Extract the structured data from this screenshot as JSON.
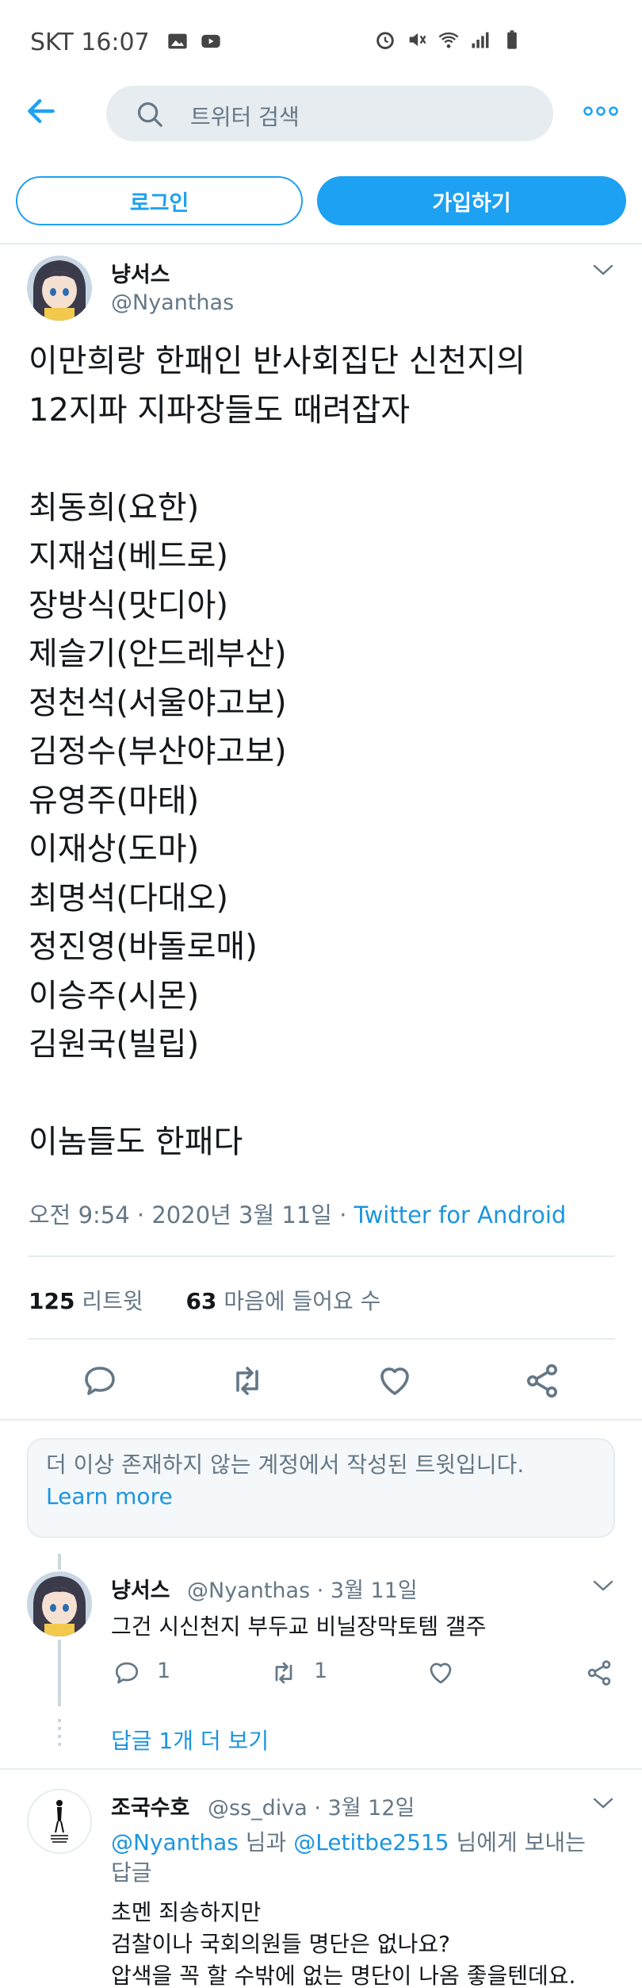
{
  "status_bar": {
    "time": "SKT 16:07"
  },
  "topbar": {
    "search_placeholder": "트위터 검색"
  },
  "auth": {
    "login_label": "로그인",
    "signup_label": "가입하기"
  },
  "main_tweet": {
    "name": "냥서스",
    "handle": "@Nyanthas",
    "lines": [
      "이만희랑 한패인 반사회집단 신천지의",
      "12지파 지파장들도 때려잡자",
      "",
      "최동희(요한)",
      "지재섭(베드로)",
      "장방식(맛디아)",
      "제슬기(안드레부산)",
      "정천석(서울야고보)",
      "김정수(부산야고보)",
      "유영주(마태)",
      "이재상(도마)",
      "최명석(다대오)",
      "정진영(바돌로매)",
      "이승주(시몬)",
      "김원국(빌립)",
      "",
      "이놈들도 한패다"
    ],
    "time_date": "오전 9:54 · 2020년 3월 11일 · ",
    "source": "Twitter for Android",
    "retweet_count": "125",
    "retweet_label": " 리트윗",
    "like_count": "63",
    "like_label": " 마음에 들어요 수"
  },
  "notice": {
    "text": "더 이상 존재하지 않는 계정에서 작성된 트윗입니다.",
    "link": "Learn more"
  },
  "reply1": {
    "name": "냥서스",
    "handle_date": "@Nyanthas · 3월 11일",
    "text": "그건 시신천지 부두교 비닐장막토템 갤주",
    "reply_count": "1",
    "retweet_count": "1",
    "more_replies": "답글 1개 더 보기"
  },
  "reply2": {
    "name": "조국수호",
    "handle_date": "@ss_diva · 3월 12일",
    "mention1": "@Nyanthas",
    "mention_mid": " 님과 ",
    "mention2": "@Letitbe2515",
    "mention_end": " 님에게 보내는",
    "mention_line2": "답글",
    "lines": [
      "초멘 죄송하지만",
      "검찰이나 국회의원들 명단은 없나요?",
      "압색을 꼭 할 수밖에 없는 명단이 나옴 좋을텐데요."
    ]
  },
  "colors": {
    "accent": "#1da1f2",
    "link": "#1b95e0",
    "muted": "#657786",
    "text": "#14171a",
    "divider": "#e6ecf0"
  }
}
